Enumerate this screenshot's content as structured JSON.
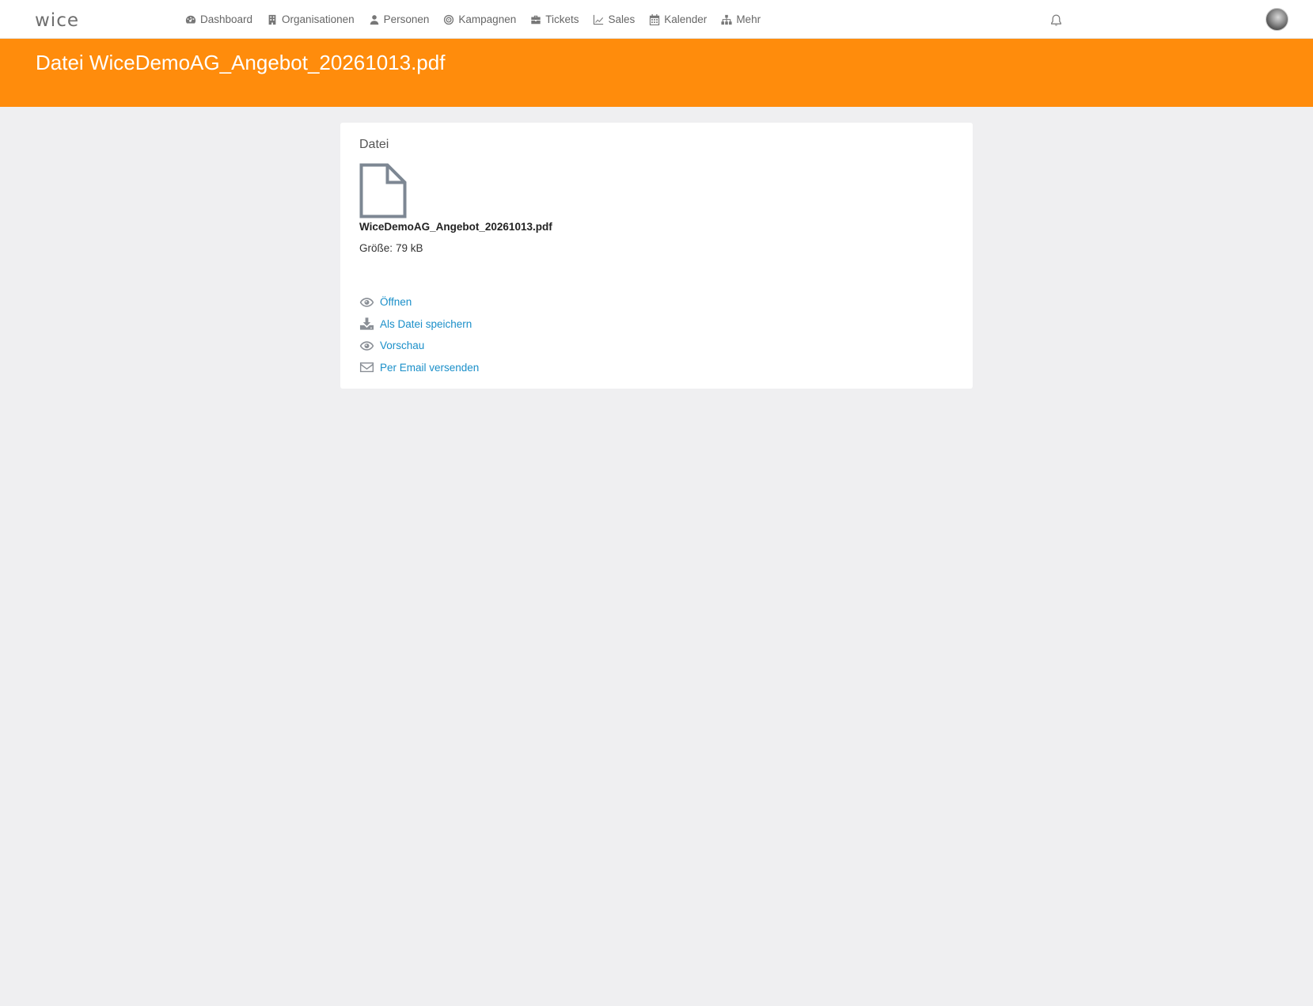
{
  "app": {
    "logo": "wice"
  },
  "nav": {
    "items": [
      {
        "label": "Dashboard",
        "icon": "dashboard-icon"
      },
      {
        "label": "Organisationen",
        "icon": "building-icon"
      },
      {
        "label": "Personen",
        "icon": "user-icon"
      },
      {
        "label": "Kampagnen",
        "icon": "target-icon"
      },
      {
        "label": "Tickets",
        "icon": "briefcase-icon"
      },
      {
        "label": "Sales",
        "icon": "line-chart-icon"
      },
      {
        "label": "Kalender",
        "icon": "calendar-icon"
      },
      {
        "label": "Mehr",
        "icon": "sitemap-icon"
      }
    ]
  },
  "header": {
    "title": "Datei WiceDemoAG_Angebot_20261013.pdf"
  },
  "file_card": {
    "section_title": "Datei",
    "file_name": "WiceDemoAG_Angebot_20261013.pdf",
    "size_label": "Größe:",
    "size_value": "79 kB",
    "actions": [
      {
        "label": "Öffnen",
        "icon": "eye-icon"
      },
      {
        "label": "Als Datei speichern",
        "icon": "download-icon"
      },
      {
        "label": "Vorschau",
        "icon": "eye-icon"
      },
      {
        "label": "Per Email versenden",
        "icon": "envelope-icon"
      }
    ]
  },
  "colors": {
    "accent": "#ff8c0c",
    "link": "#1a8fc9",
    "background": "#efeff1"
  }
}
